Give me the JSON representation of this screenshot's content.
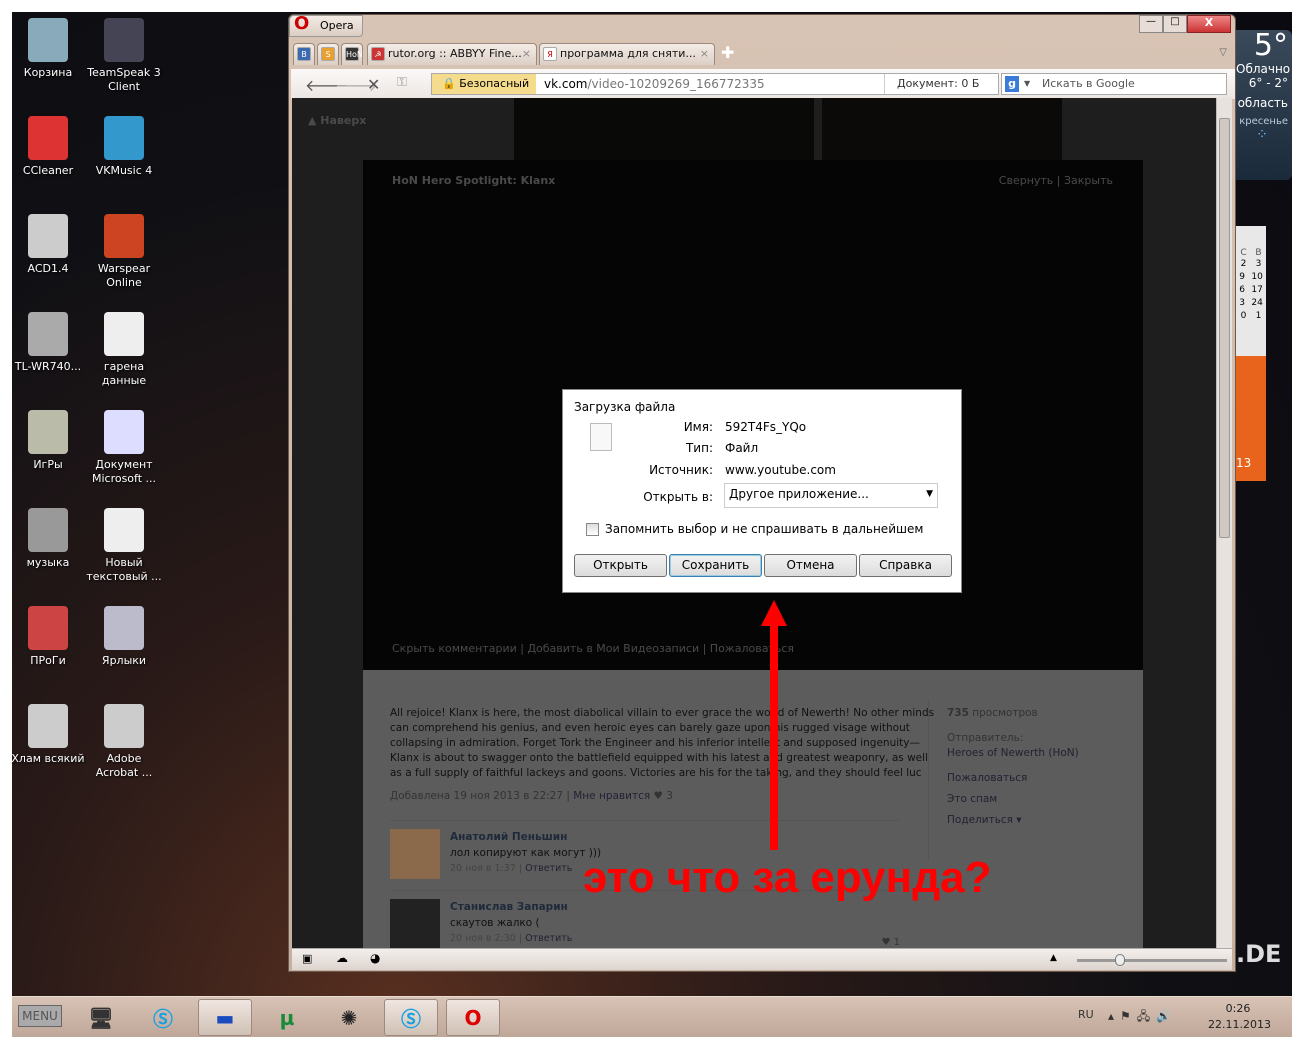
{
  "desktop": {
    "icons": [
      {
        "label": "Корзина",
        "color": "#8ab"
      },
      {
        "label": "TeamSpeak 3 Client",
        "color": "#445"
      },
      {
        "label": "CCleaner",
        "color": "#d33"
      },
      {
        "label": "VKMusic 4",
        "color": "#39c"
      },
      {
        "label": "ACD1.4",
        "color": "#ccc"
      },
      {
        "label": "Warspear Online",
        "color": "#c42"
      },
      {
        "label": "TL-WR740...",
        "color": "#aaa"
      },
      {
        "label": "гарена данные",
        "color": "#eee"
      },
      {
        "label": "ИгРы",
        "color": "#bba"
      },
      {
        "label": "Документ Microsoft ...",
        "color": "#ddf"
      },
      {
        "label": "музыка",
        "color": "#999"
      },
      {
        "label": "Новый текстовый ...",
        "color": "#eee"
      },
      {
        "label": "ПРоГи",
        "color": "#c44"
      },
      {
        "label": "Ярлыки",
        "color": "#bbc"
      },
      {
        "label": "Хлам всякий",
        "color": "#ccc"
      },
      {
        "label": "Adobe Acrobat ...",
        "color": "#ccc"
      }
    ]
  },
  "gadgets": {
    "weather": {
      "temp": "5°",
      "condition": "Облачно",
      "range": "6° - 2°",
      "region": "область",
      "day": "кресенье"
    },
    "calendar": {
      "headers": [
        "С",
        "В"
      ],
      "rows": [
        [
          "2",
          "3"
        ],
        [
          "9",
          "10"
        ],
        [
          "6",
          "17"
        ],
        [
          "3",
          "24"
        ],
        [
          "0",
          "1"
        ]
      ],
      "footer": "13"
    },
    "watermark": ".DE"
  },
  "browser": {
    "app_title": "Opera",
    "tabs": [
      {
        "label": "",
        "icon": "В"
      },
      {
        "label": "",
        "icon": "S"
      },
      {
        "label": "",
        "icon": "HoN"
      },
      {
        "label": "rutor.org :: ABBYY Fine...",
        "icon": "☭"
      },
      {
        "label": "программа для сняти...",
        "icon": "Я"
      }
    ],
    "nav": {
      "security_label": "Безопасный",
      "url_host": "vk.com",
      "url_path": "/video-10209269_166772335",
      "doc_label": "Документ:",
      "doc_size": "0 Б",
      "search_placeholder": "Искать в Google"
    }
  },
  "page": {
    "top_link": "Наверх",
    "video_title": "HoN Hero Spotlight: Klanx",
    "minimize": "Свернуть",
    "close": "Закрыть",
    "actions": [
      "Скрыть комментарии",
      "Добавить в Мои Видеозаписи",
      "Пожаловаться"
    ],
    "description": [
      "All rejoice! Klanx is here, the most diabolical villain to ever grace the world of Newerth! No other minds",
      "can comprehend his genius, and even heroic eyes can barely gaze upon his rugged visage without",
      "collapsing in admiration. Forget Tork the Engineer and his inferior intellect and supposed ingenuity—",
      "Klanx is about to swagger onto the battlefield equipped with his latest and greatest weaponry, as well",
      "as a full supply of faithful lackeys and goons. Victories are his for the taking, and they should feel luc"
    ],
    "added": "Добавлена 19 ноя 2013 в 22:27",
    "like_label": "Мне нравится",
    "likes": "3",
    "views_count": "735",
    "views_label": "просмотров",
    "sender_label": "Отправитель:",
    "sender": "Heroes of Newerth (HoN)",
    "side_links": [
      "Пожаловаться",
      "Это спам",
      "Поделиться ▾"
    ],
    "comments": [
      {
        "author": "Анатолий Пеньшин",
        "text": "лол копируют как могут )))",
        "date": "20 ноя в 1:37",
        "reply": "Ответить",
        "likes": ""
      },
      {
        "author": "Станислав Запарин",
        "text": "скаутов жалко (",
        "date": "20 ноя в 2:30",
        "reply": "Ответить",
        "likes": "1"
      }
    ]
  },
  "dialog": {
    "title": "Загрузка файла",
    "name_label": "Имя:",
    "name": "592T4Fs_YQo",
    "type_label": "Тип:",
    "type": "Файл",
    "source_label": "Источник:",
    "source": "www.youtube.com",
    "open_in_label": "Открыть в:",
    "open_in": "Другое приложение...",
    "remember": "Запомнить выбор и не спрашивать в дальнейшем",
    "buttons": {
      "open": "Открыть",
      "save": "Сохранить",
      "cancel": "Отмена",
      "help": "Справка"
    }
  },
  "annotation": {
    "text": "это что за ерунда?",
    "color": "#ff0000"
  },
  "taskbar": {
    "menu": "MENU",
    "lang": "RU",
    "time": "0:26",
    "date": "22.11.2013"
  }
}
